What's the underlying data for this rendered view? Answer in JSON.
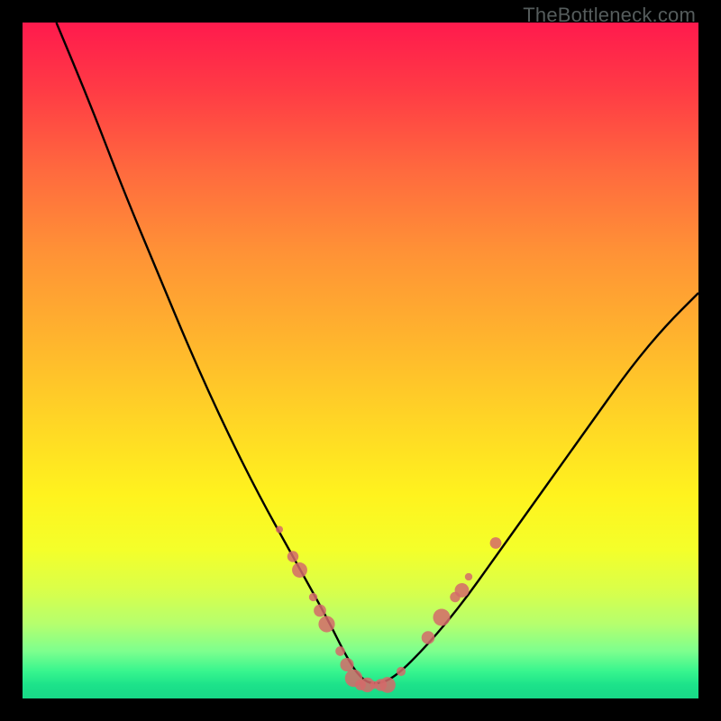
{
  "attribution": "TheBottleneck.com",
  "chart_data": {
    "type": "line",
    "title": "",
    "xlabel": "",
    "ylabel": "",
    "xlim": [
      0,
      100
    ],
    "ylim": [
      0,
      100
    ],
    "grid": false,
    "legend": false,
    "background_gradient": {
      "top": "#ff1a4d",
      "middle": "#ffd326",
      "bottom": "#18d987"
    },
    "series": [
      {
        "name": "bottleneck-curve",
        "color": "#000000",
        "x": [
          5,
          10,
          15,
          20,
          25,
          30,
          35,
          40,
          45,
          48,
          50,
          52,
          55,
          60,
          65,
          70,
          75,
          80,
          85,
          90,
          95,
          100
        ],
        "y": [
          100,
          88,
          75,
          63,
          51,
          40,
          30,
          21,
          12,
          6,
          3,
          2,
          3,
          8,
          14,
          21,
          28,
          35,
          42,
          49,
          55,
          60
        ]
      }
    ],
    "markers": [
      {
        "name": "data-points",
        "color": "#d46a6a",
        "shape": "circle",
        "radius_range": [
          4,
          10
        ],
        "points": [
          {
            "x": 38,
            "y": 25
          },
          {
            "x": 40,
            "y": 21
          },
          {
            "x": 41,
            "y": 19
          },
          {
            "x": 43,
            "y": 15
          },
          {
            "x": 44,
            "y": 13
          },
          {
            "x": 45,
            "y": 11
          },
          {
            "x": 47,
            "y": 7
          },
          {
            "x": 48,
            "y": 5
          },
          {
            "x": 49,
            "y": 3
          },
          {
            "x": 50,
            "y": 2
          },
          {
            "x": 51,
            "y": 2
          },
          {
            "x": 52,
            "y": 2
          },
          {
            "x": 53,
            "y": 2
          },
          {
            "x": 54,
            "y": 2
          },
          {
            "x": 56,
            "y": 4
          },
          {
            "x": 60,
            "y": 9
          },
          {
            "x": 62,
            "y": 12
          },
          {
            "x": 64,
            "y": 15
          },
          {
            "x": 65,
            "y": 16
          },
          {
            "x": 66,
            "y": 18
          },
          {
            "x": 70,
            "y": 23
          }
        ]
      }
    ]
  }
}
